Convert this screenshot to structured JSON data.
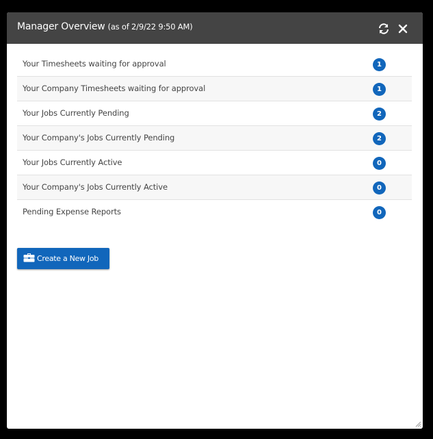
{
  "header": {
    "title": "Manager Overview",
    "subtitle": "(as of 2/9/22 9:50 AM)",
    "refresh_icon": "refresh-icon",
    "close_icon": "close-icon"
  },
  "rows": [
    {
      "label": "Your Timesheets waiting for approval",
      "count": "1"
    },
    {
      "label": "Your Company Timesheets waiting for approval",
      "count": "1"
    },
    {
      "label": "Your Jobs Currently Pending",
      "count": "2"
    },
    {
      "label": "Your Company's Jobs Currently Pending",
      "count": "2"
    },
    {
      "label": "Your Jobs Currently Active",
      "count": "0"
    },
    {
      "label": "Your Company's Jobs Currently Active",
      "count": "0"
    },
    {
      "label": "Pending Expense Reports",
      "count": "0"
    }
  ],
  "create_button": {
    "label": "Create a New Job",
    "icon": "briefcase-icon"
  },
  "colors": {
    "header_bg": "#444444",
    "accent": "#1166bb",
    "text": "#444444",
    "alt_row": "#f7f7f7"
  }
}
